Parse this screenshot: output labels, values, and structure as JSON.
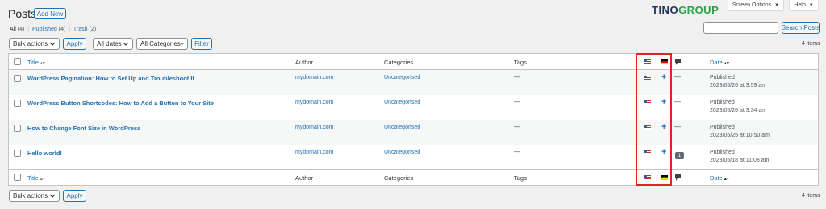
{
  "header": {
    "title": "Posts",
    "add_new": "Add New",
    "logo_part1": "TINO",
    "logo_part2": "GROUP",
    "screen_options": "Screen Options",
    "help": "Help"
  },
  "views": {
    "all": "All",
    "all_count": "(4)",
    "published": "Published",
    "published_count": "(4)",
    "trash": "Trash",
    "trash_count": "(2)"
  },
  "search": {
    "value": "",
    "button": "Search Posts"
  },
  "filters": {
    "bulk_actions": "Bulk actions",
    "apply": "Apply",
    "dates": "All dates",
    "categories": "All Categories",
    "filter": "Filter"
  },
  "items_count": "4 items",
  "columns": {
    "title": "Title",
    "author": "Author",
    "categories": "Categories",
    "tags": "Tags",
    "date": "Date"
  },
  "rows": [
    {
      "title": "WordPress Pagination: How to Set Up and Troubleshoot It",
      "author": "mydomain.com",
      "category": "Uncategorised",
      "tags": "—",
      "comments": "—",
      "status": "Published",
      "date": "2023/05/26 at 3:59 am"
    },
    {
      "title": "WordPress Button Shortcodes: How to Add a Button to Your Site",
      "author": "mydomain.com",
      "category": "Uncategorised",
      "tags": "—",
      "comments": "—",
      "status": "Published",
      "date": "2023/05/26 at 3:34 am"
    },
    {
      "title": "How to Change Font Size in WordPress",
      "author": "mydomain.com",
      "category": "Uncategorised",
      "tags": "—",
      "comments": "—",
      "status": "Published",
      "date": "2023/05/25 at 10:50 am"
    },
    {
      "title": "Hello world!",
      "author": "mydomain.com",
      "category": "Uncategorised",
      "tags": "—",
      "comments": "1",
      "status": "Published",
      "date": "2023/05/18 at 11:08 am"
    }
  ],
  "colors": {
    "link": "#2271b1",
    "highlight": "#e32129",
    "logo_dark": "#1f3657",
    "logo_green": "#2ea04b"
  },
  "icons": [
    "us-flag-icon",
    "de-flag-icon",
    "comment-bubble-icon",
    "plus-icon",
    "sort-arrows-icon",
    "chevron-down-icon"
  ]
}
